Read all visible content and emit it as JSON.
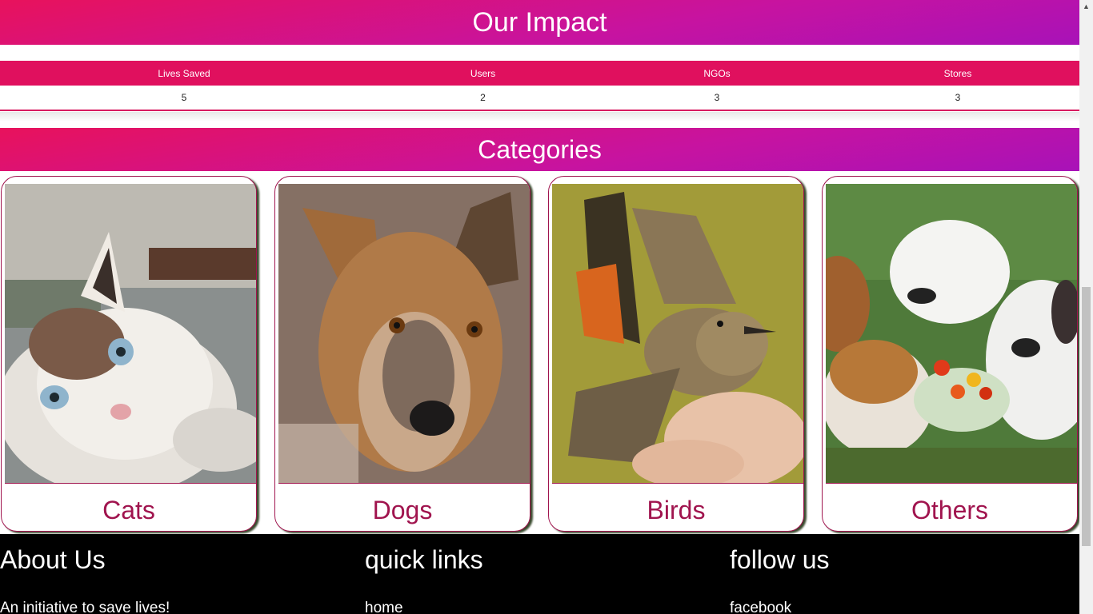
{
  "impact": {
    "title": "Our Impact",
    "headers": [
      "Lives Saved",
      "Users",
      "NGOs",
      "Stores"
    ],
    "values": [
      "5",
      "2",
      "3",
      "3"
    ]
  },
  "categories": {
    "title": "Categories",
    "items": [
      {
        "label": "Cats",
        "image": "cat-photo"
      },
      {
        "label": "Dogs",
        "image": "dog-photo"
      },
      {
        "label": "Birds",
        "image": "bird-photo"
      },
      {
        "label": "Others",
        "image": "rabbits-guinea-pigs-photo"
      }
    ]
  },
  "footer": {
    "about": {
      "title": "About Us",
      "text": "An initiative to save lives!"
    },
    "quick_links": {
      "title": "quick links",
      "first_link": "home"
    },
    "follow": {
      "title": "follow us",
      "first_link": "facebook"
    }
  },
  "colors": {
    "accent": "#e0105e",
    "gradient_end": "#a812b8",
    "card_border": "#a0144e"
  }
}
